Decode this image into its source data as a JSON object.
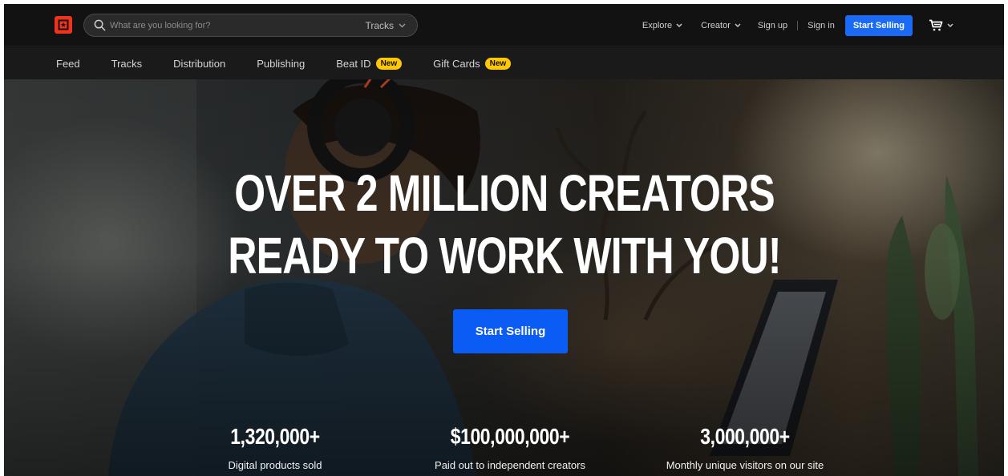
{
  "header": {
    "search": {
      "placeholder": "What are you looking for?",
      "type_label": "Tracks"
    },
    "nav": {
      "explore": "Explore",
      "creator": "Creator",
      "sign_up": "Sign up",
      "sign_in": "Sign in",
      "start_selling": "Start Selling"
    }
  },
  "subnav": {
    "items": [
      {
        "label": "Feed"
      },
      {
        "label": "Tracks"
      },
      {
        "label": "Distribution"
      },
      {
        "label": "Publishing"
      },
      {
        "label": "Beat ID",
        "badge": "New"
      },
      {
        "label": "Gift Cards",
        "badge": "New"
      }
    ]
  },
  "hero": {
    "headline_line1": "OVER 2 MILLION CREATORS",
    "headline_line2": "READY TO WORK WITH YOU!",
    "cta": "Start Selling",
    "stats": [
      {
        "value": "1,320,000+",
        "label": "Digital products sold"
      },
      {
        "value": "$100,000,000+",
        "label": "Paid out to independent creators"
      },
      {
        "value": "3,000,000+",
        "label": "Monthly unique visitors on our site"
      }
    ]
  },
  "colors": {
    "brand_red": "#f0321e",
    "accent_blue": "#0b5cf5",
    "badge_yellow": "#ffc800",
    "topbar_bg": "#121212"
  },
  "icons": [
    "logo-icon",
    "search-icon",
    "chevron-down-icon",
    "cart-icon"
  ]
}
